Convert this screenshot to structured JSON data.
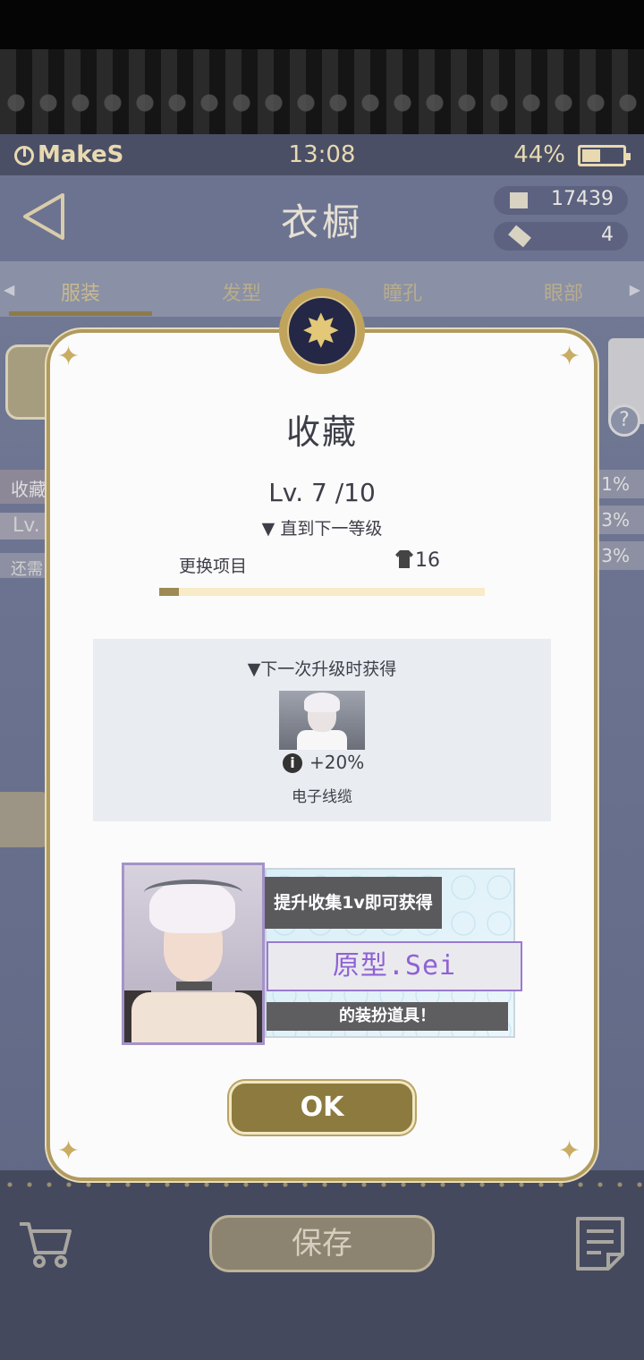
{
  "status_bar": {
    "brand": "MakeS",
    "time": "13:08",
    "battery": "44%",
    "battery_level": 0.44
  },
  "header": {
    "title": "衣橱",
    "currency": [
      {
        "icon": "ticket-icon",
        "value": "17439"
      },
      {
        "icon": "tag-icon",
        "value": "4"
      }
    ]
  },
  "tabs": [
    "服装",
    "发型",
    "瞳孔",
    "眼部"
  ],
  "background_panel": {
    "label_collection": "收藏",
    "label_level": "Lv.",
    "label_remaining": "还需",
    "percents": [
      "1%",
      "3%",
      "3%"
    ],
    "help": "?"
  },
  "dialog": {
    "title": "收藏",
    "level": "Lv. 7 /10",
    "until_next": "▼ 直到下一等级",
    "swap_label": "更换项目",
    "swap_count": "16",
    "progress_fraction": 0.06,
    "next_title": "▼下一次升级时获得",
    "next_bonus": "+20%",
    "next_info_icon": "i",
    "next_item_name": "电子线缆",
    "reward_line1": "提升收集1v即可获得",
    "reward_name": "原型.Sei",
    "reward_line3": "的装扮道具！",
    "ok_label": "OK"
  },
  "bottom": {
    "save_label": "保存"
  },
  "colors": {
    "gold": "#b09a5e",
    "accent_purple": "#8f62d4",
    "ok_button": "#8d7a3e"
  }
}
